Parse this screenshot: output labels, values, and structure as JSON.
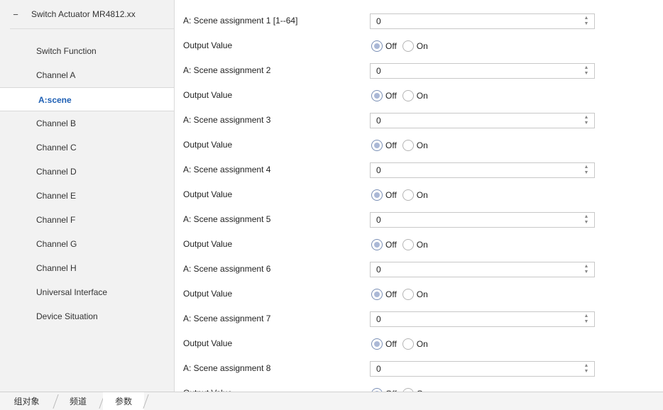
{
  "sidebar": {
    "root": {
      "collapse_symbol": "−",
      "label": "Switch Actuator MR4812.xx"
    },
    "items": [
      {
        "label": "Switch Function"
      },
      {
        "label": "Channel A"
      },
      {
        "label": "A:scene"
      },
      {
        "label": "Channel B"
      },
      {
        "label": "Channel C"
      },
      {
        "label": "Channel D"
      },
      {
        "label": "Channel E"
      },
      {
        "label": "Channel F"
      },
      {
        "label": "Channel G"
      },
      {
        "label": "Channel H"
      },
      {
        "label": "Universal Interface"
      },
      {
        "label": "Device Situation"
      }
    ],
    "selected_index": 2
  },
  "main": {
    "scenes": [
      {
        "label": "A: Scene assignment 1 [1--64]",
        "value": "0",
        "output_label": "Output Value",
        "off_label": "Off",
        "on_label": "On",
        "selected": "Off"
      },
      {
        "label": "A: Scene assignment 2",
        "value": "0",
        "output_label": "Output Value",
        "off_label": "Off",
        "on_label": "On",
        "selected": "Off"
      },
      {
        "label": "A: Scene assignment 3",
        "value": "0",
        "output_label": "Output Value",
        "off_label": "Off",
        "on_label": "On",
        "selected": "Off"
      },
      {
        "label": "A: Scene assignment 4",
        "value": "0",
        "output_label": "Output Value",
        "off_label": "Off",
        "on_label": "On",
        "selected": "Off"
      },
      {
        "label": "A: Scene assignment 5",
        "value": "0",
        "output_label": "Output Value",
        "off_label": "Off",
        "on_label": "On",
        "selected": "Off"
      },
      {
        "label": "A: Scene assignment 6",
        "value": "0",
        "output_label": "Output Value",
        "off_label": "Off",
        "on_label": "On",
        "selected": "Off"
      },
      {
        "label": "A: Scene assignment 7",
        "value": "0",
        "output_label": "Output Value",
        "off_label": "Off",
        "on_label": "On",
        "selected": "Off"
      },
      {
        "label": "A: Scene assignment 8",
        "value": "0",
        "output_label": "Output Value",
        "off_label": "Off",
        "on_label": "On",
        "selected": "Off"
      }
    ],
    "spin_up_icon": "spin-up-icon",
    "spin_down_icon": "spin-down-icon"
  },
  "tabs": [
    {
      "label": "组对象"
    },
    {
      "label": "频道"
    },
    {
      "label": "参数"
    }
  ],
  "active_tab": 2,
  "colors": {
    "selected_text": "#1e5fb4",
    "sidebar_bg": "#f2f2f2",
    "radio_fill": "#aab8d6"
  }
}
